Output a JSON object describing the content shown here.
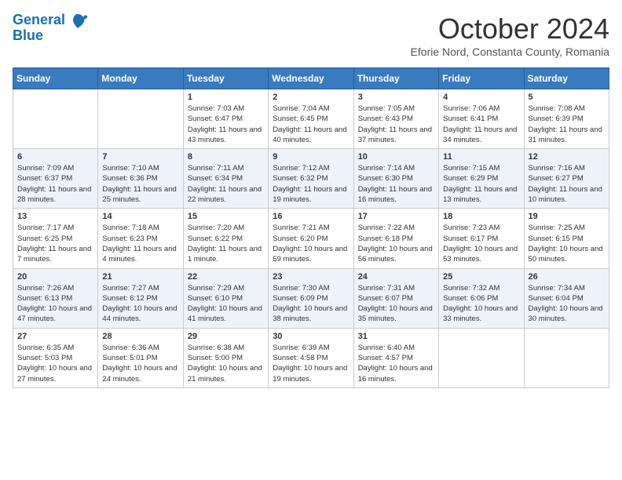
{
  "app": {
    "name_line1": "General",
    "name_line2": "Blue"
  },
  "header": {
    "month": "October 2024",
    "location": "Eforie Nord, Constanta County, Romania"
  },
  "weekdays": [
    "Sunday",
    "Monday",
    "Tuesday",
    "Wednesday",
    "Thursday",
    "Friday",
    "Saturday"
  ],
  "weeks": [
    [
      {
        "day": "",
        "sunrise": "",
        "sunset": "",
        "daylight": ""
      },
      {
        "day": "",
        "sunrise": "",
        "sunset": "",
        "daylight": ""
      },
      {
        "day": "1",
        "sunrise": "Sunrise: 7:03 AM",
        "sunset": "Sunset: 6:47 PM",
        "daylight": "Daylight: 11 hours and 43 minutes."
      },
      {
        "day": "2",
        "sunrise": "Sunrise: 7:04 AM",
        "sunset": "Sunset: 6:45 PM",
        "daylight": "Daylight: 11 hours and 40 minutes."
      },
      {
        "day": "3",
        "sunrise": "Sunrise: 7:05 AM",
        "sunset": "Sunset: 6:43 PM",
        "daylight": "Daylight: 11 hours and 37 minutes."
      },
      {
        "day": "4",
        "sunrise": "Sunrise: 7:06 AM",
        "sunset": "Sunset: 6:41 PM",
        "daylight": "Daylight: 11 hours and 34 minutes."
      },
      {
        "day": "5",
        "sunrise": "Sunrise: 7:08 AM",
        "sunset": "Sunset: 6:39 PM",
        "daylight": "Daylight: 11 hours and 31 minutes."
      }
    ],
    [
      {
        "day": "6",
        "sunrise": "Sunrise: 7:09 AM",
        "sunset": "Sunset: 6:37 PM",
        "daylight": "Daylight: 11 hours and 28 minutes."
      },
      {
        "day": "7",
        "sunrise": "Sunrise: 7:10 AM",
        "sunset": "Sunset: 6:36 PM",
        "daylight": "Daylight: 11 hours and 25 minutes."
      },
      {
        "day": "8",
        "sunrise": "Sunrise: 7:11 AM",
        "sunset": "Sunset: 6:34 PM",
        "daylight": "Daylight: 11 hours and 22 minutes."
      },
      {
        "day": "9",
        "sunrise": "Sunrise: 7:12 AM",
        "sunset": "Sunset: 6:32 PM",
        "daylight": "Daylight: 11 hours and 19 minutes."
      },
      {
        "day": "10",
        "sunrise": "Sunrise: 7:14 AM",
        "sunset": "Sunset: 6:30 PM",
        "daylight": "Daylight: 11 hours and 16 minutes."
      },
      {
        "day": "11",
        "sunrise": "Sunrise: 7:15 AM",
        "sunset": "Sunset: 6:29 PM",
        "daylight": "Daylight: 11 hours and 13 minutes."
      },
      {
        "day": "12",
        "sunrise": "Sunrise: 7:16 AM",
        "sunset": "Sunset: 6:27 PM",
        "daylight": "Daylight: 11 hours and 10 minutes."
      }
    ],
    [
      {
        "day": "13",
        "sunrise": "Sunrise: 7:17 AM",
        "sunset": "Sunset: 6:25 PM",
        "daylight": "Daylight: 11 hours and 7 minutes."
      },
      {
        "day": "14",
        "sunrise": "Sunrise: 7:18 AM",
        "sunset": "Sunset: 6:23 PM",
        "daylight": "Daylight: 11 hours and 4 minutes."
      },
      {
        "day": "15",
        "sunrise": "Sunrise: 7:20 AM",
        "sunset": "Sunset: 6:22 PM",
        "daylight": "Daylight: 11 hours and 1 minute."
      },
      {
        "day": "16",
        "sunrise": "Sunrise: 7:21 AM",
        "sunset": "Sunset: 6:20 PM",
        "daylight": "Daylight: 10 hours and 59 minutes."
      },
      {
        "day": "17",
        "sunrise": "Sunrise: 7:22 AM",
        "sunset": "Sunset: 6:18 PM",
        "daylight": "Daylight: 10 hours and 56 minutes."
      },
      {
        "day": "18",
        "sunrise": "Sunrise: 7:23 AM",
        "sunset": "Sunset: 6:17 PM",
        "daylight": "Daylight: 10 hours and 53 minutes."
      },
      {
        "day": "19",
        "sunrise": "Sunrise: 7:25 AM",
        "sunset": "Sunset: 6:15 PM",
        "daylight": "Daylight: 10 hours and 50 minutes."
      }
    ],
    [
      {
        "day": "20",
        "sunrise": "Sunrise: 7:26 AM",
        "sunset": "Sunset: 6:13 PM",
        "daylight": "Daylight: 10 hours and 47 minutes."
      },
      {
        "day": "21",
        "sunrise": "Sunrise: 7:27 AM",
        "sunset": "Sunset: 6:12 PM",
        "daylight": "Daylight: 10 hours and 44 minutes."
      },
      {
        "day": "22",
        "sunrise": "Sunrise: 7:29 AM",
        "sunset": "Sunset: 6:10 PM",
        "daylight": "Daylight: 10 hours and 41 minutes."
      },
      {
        "day": "23",
        "sunrise": "Sunrise: 7:30 AM",
        "sunset": "Sunset: 6:09 PM",
        "daylight": "Daylight: 10 hours and 38 minutes."
      },
      {
        "day": "24",
        "sunrise": "Sunrise: 7:31 AM",
        "sunset": "Sunset: 6:07 PM",
        "daylight": "Daylight: 10 hours and 35 minutes."
      },
      {
        "day": "25",
        "sunrise": "Sunrise: 7:32 AM",
        "sunset": "Sunset: 6:06 PM",
        "daylight": "Daylight: 10 hours and 33 minutes."
      },
      {
        "day": "26",
        "sunrise": "Sunrise: 7:34 AM",
        "sunset": "Sunset: 6:04 PM",
        "daylight": "Daylight: 10 hours and 30 minutes."
      }
    ],
    [
      {
        "day": "27",
        "sunrise": "Sunrise: 6:35 AM",
        "sunset": "Sunset: 5:03 PM",
        "daylight": "Daylight: 10 hours and 27 minutes."
      },
      {
        "day": "28",
        "sunrise": "Sunrise: 6:36 AM",
        "sunset": "Sunset: 5:01 PM",
        "daylight": "Daylight: 10 hours and 24 minutes."
      },
      {
        "day": "29",
        "sunrise": "Sunrise: 6:38 AM",
        "sunset": "Sunset: 5:00 PM",
        "daylight": "Daylight: 10 hours and 21 minutes."
      },
      {
        "day": "30",
        "sunrise": "Sunrise: 6:39 AM",
        "sunset": "Sunset: 4:58 PM",
        "daylight": "Daylight: 10 hours and 19 minutes."
      },
      {
        "day": "31",
        "sunrise": "Sunrise: 6:40 AM",
        "sunset": "Sunset: 4:57 PM",
        "daylight": "Daylight: 10 hours and 16 minutes."
      },
      {
        "day": "",
        "sunrise": "",
        "sunset": "",
        "daylight": ""
      },
      {
        "day": "",
        "sunrise": "",
        "sunset": "",
        "daylight": ""
      }
    ]
  ]
}
